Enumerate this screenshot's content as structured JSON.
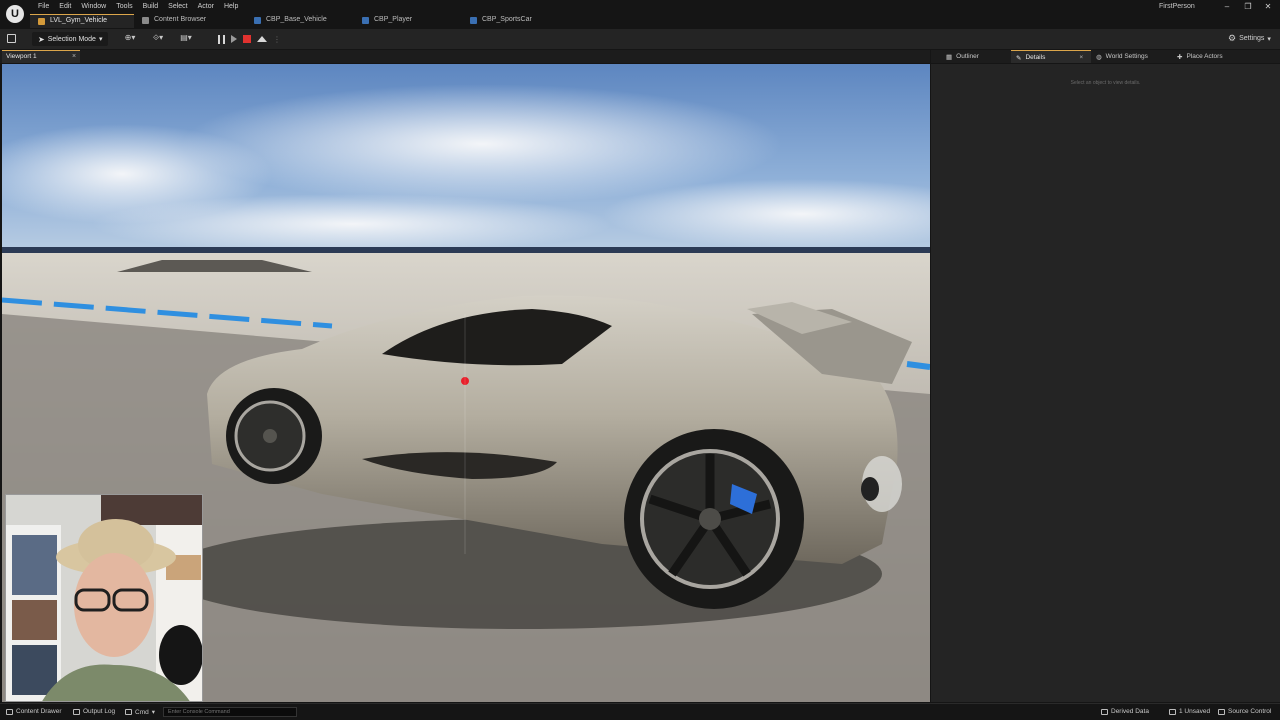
{
  "menu": [
    "File",
    "Edit",
    "Window",
    "Tools",
    "Build",
    "Select",
    "Actor",
    "Help"
  ],
  "doc_tabs": [
    {
      "label": "LVL_Gym_Vehicle",
      "active": true
    },
    {
      "label": "Content Browser",
      "active": false
    },
    {
      "label": "CBP_Base_Vehicle",
      "active": false
    },
    {
      "label": "CBP_Player",
      "active": false
    },
    {
      "label": "CBP_SportsCar",
      "active": false
    }
  ],
  "project_name": "FirstPerson",
  "toolbar": {
    "mode_label": "Selection Mode",
    "settings_label": "Settings"
  },
  "viewport": {
    "tab_label": "Viewport 1",
    "close_glyph": "×"
  },
  "side_panel": {
    "tabs": [
      {
        "label": "Outliner"
      },
      {
        "label": "Details"
      },
      {
        "label": "World Settings"
      },
      {
        "label": "Place Actors"
      }
    ],
    "close_glyph": "×",
    "empty_message": "Select an object to view details."
  },
  "statusbar": {
    "content_drawer": "Content Drawer",
    "output_log": "Output Log",
    "cmd": "Cmd",
    "console_placeholder": "Enter Console Command",
    "derived_data": "Derived Data",
    "unsaved": "1 Unsaved",
    "source_control": "Source Control"
  },
  "colors": {
    "accent": "#dca64b",
    "stop": "#e0322f",
    "panel": "#242424",
    "chrome": "#151515"
  }
}
